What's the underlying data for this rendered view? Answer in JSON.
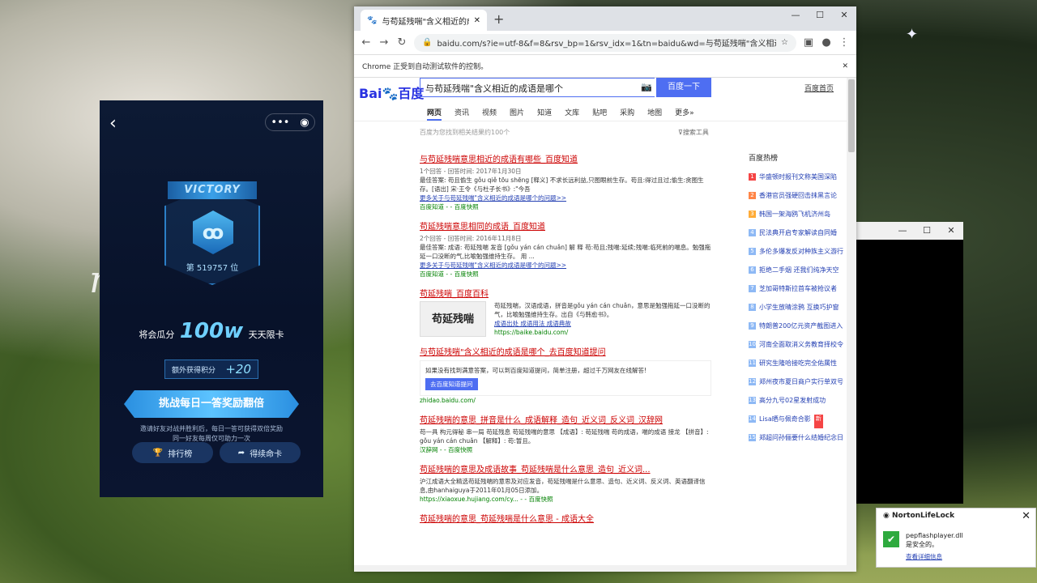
{
  "wallpaper": {
    "text": "miu"
  },
  "phone": {
    "victory_label": "VICTORY",
    "rank_text": "第 519757 位",
    "prize_prefix": "将会瓜分",
    "prize_amount": "100w",
    "prize_suffix": "天天限卡",
    "bonus_label": "额外获得积分",
    "bonus_value": "+20",
    "cta_label": "挑战每日一答奖励翻倍",
    "invite_line1": "邀请好友对战并胜利后，每日一答可获得双倍奖励",
    "invite_line2": "同一好友每周仅可助力一次",
    "leaderboard_label": "排行榜",
    "revive_label": "得续命卡"
  },
  "chrome": {
    "tab_title": "与苟延残喘\"含义相近的成语是哪",
    "url": "baidu.com/s?ie=utf-8&f=8&rsv_bp=1&rsv_idx=1&tn=baidu&wd=与苟延残喘\"含义相近的成...",
    "infobar_text": "Chrome 正受到自动测试软件的控制。"
  },
  "baidu": {
    "logo_left": "Bai",
    "logo_right": "百度",
    "query": "与苟延残喘\"含义相近的成语是哪个",
    "search_button": "百度一下",
    "home_link": "百度首页",
    "tabs": [
      "网页",
      "资讯",
      "视频",
      "图片",
      "知道",
      "文库",
      "贴吧",
      "采购",
      "地图",
      "更多»"
    ],
    "result_count": "百度为您找到相关结果约100个",
    "search_tools": "搜索工具",
    "results": [
      {
        "title": "与苟延残喘意思相近的成语有哪些_百度知道",
        "info": "1个回答 - 回答时间: 2017年1月30日",
        "body": "最佳答案: 苟且偷生 gǒu qiě tōu shēng [释义] 不求长远利益,只图眼前生存。苟且:得过且过;偷生:贪图生存。[语出] 宋·王令《与杜子长书》:\"今吾",
        "more": "更多关于与苟延残喘\"含义相近的成语是哪个的问题>>",
        "source": "百度知道 - - 百度快照"
      },
      {
        "title": "苟延残喘意思相同的成语_百度知道",
        "info": "2个回答 - 回答时间: 2016年11月8日",
        "body": "最佳答案: 成语: 苟延残喘 发音 [gǒu yán cán chuǎn] 解 释 苟:苟且;残喘:延续;残喘:临死前的喘息。勉强拖延一口没断的气,比喻勉强维持生存。 用 ...",
        "more": "更多关于与苟延残喘\"含义相近的成语是哪个的问题>>",
        "source": "百度知道 - - 百度快照"
      }
    ],
    "baike": {
      "title": "苟延残喘_百度百科",
      "image_text": "苟延残喘",
      "body": "苟延残喘，汉语成语，拼音是gǒu yán cán chuǎn，意思是勉强拖延一口没断的气，比喻勉强维持生存。出自《与韩愈书》。",
      "links": "成语出处  成语用法  成语典故",
      "url": "https://baike.baidu.com/"
    },
    "zhidao": {
      "title": "与苟延残喘\"含义相近的成语是哪个_去百度知道提问",
      "box_text": "如果没有找到满意答案，可以到百度知道提问，简单注册，超过千万网友在线解答!",
      "button": "去百度知道提问",
      "url": "zhidao.baidu.com/"
    },
    "more_results": [
      {
        "title": "苟延残喘的意思_拼音是什么_成语解释_造句_近义词_反义词_汉辞网",
        "body": "苟一具 构元得秘 串一局 苟延残息 苟延残喘的意思 【成语】: 苟延残喘 苟的成语，喘的成语 接龙 【拼音】: gǒu yán cán chuǎn 【解释】: 苟:暂且。",
        "source": "汉辞网 - - 百度快照"
      },
      {
        "title": "苟延残喘的意思及成语故事_苟延残喘是什么意思_造句_近义词...",
        "body": "沪江成语大全精选苟延残喘的意思及对应发音，苟延残喘是什么意思、造句、近义词、反义词、英语翻译信息,由hanhaiguya于2011年01月05日添加。",
        "source": "https://xiaoxue.hujiang.com/cy... - - 百度快照"
      },
      {
        "title": "苟延残喘的意思_苟延残喘是什么意思 - 成语大全"
      }
    ],
    "hot_title": "百度热榜",
    "hot_items": [
      "华盛顿时报刊文称美国深陷",
      "香港官员强硬回击抹黑言论",
      "韩国一架海鸥飞机济州岛",
      "民法典开启专家解读自同婚",
      "多伦多爆发反对种族主义游行",
      "拒绝二手烟 还我们纯净天空",
      "芝加哥特斯拉首车被抢议者",
      "小学生放晴涂鸦 互换巧护窗",
      "特朗普200亿元资产截图进入",
      "河南全面取消义务教育择校令",
      "研究生隆哈接吃完全佑属性",
      "郑州夜市夏日商户实行单双号",
      "高分九号02星发射成功",
      "Lisa晒与佩奇合影",
      "郑超问孙俪要什么结婚纪念日"
    ],
    "hot_new_tag": "新"
  },
  "norton": {
    "brand": "NortonLifeLock",
    "file": "pepflashplayer.dll",
    "status": "是安全的。",
    "details_link": "查看详细信息"
  },
  "colors": {
    "baidu_blue": "#4e6ef2",
    "result_red": "#c00",
    "link_blue": "#2440b3",
    "norton_green": "#2eaa3e"
  }
}
